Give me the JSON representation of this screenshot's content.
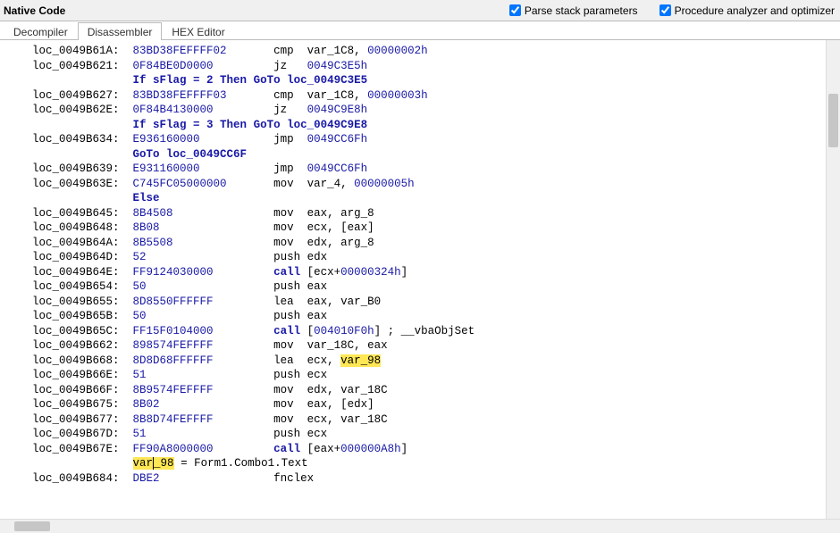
{
  "header": {
    "title": "Native Code",
    "checkbox1": {
      "label": "Parse stack parameters",
      "checked": true
    },
    "checkbox2": {
      "label": "Procedure analyzer and optimizer",
      "checked": true
    }
  },
  "tabs": [
    {
      "label": "Decompiler",
      "active": false
    },
    {
      "label": "Disassembler",
      "active": true
    },
    {
      "label": "HEX Editor",
      "active": false
    }
  ],
  "code_lines": [
    {
      "t": "asm",
      "addr": "loc_0049B61A:",
      "hex": "83BD38FEFFFF02",
      "mn": "cmp",
      "args": [
        {
          "v": "var_1C8"
        },
        ", ",
        {
          "v": "00000002h",
          "c": "num"
        }
      ]
    },
    {
      "t": "asm",
      "addr": "loc_0049B621:",
      "hex": "0F84BE0D0000",
      "mn": "jz",
      "args": [
        {
          "v": "0049C3E5h",
          "c": "ref"
        }
      ]
    },
    {
      "t": "pseudo",
      "text_pre": "If sFlag = 2 Then ",
      "kw": "GoTo",
      "text_post": " loc_0049C3E5"
    },
    {
      "t": "asm",
      "addr": "loc_0049B627:",
      "hex": "83BD38FEFFFF03",
      "mn": "cmp",
      "args": [
        {
          "v": "var_1C8"
        },
        ", ",
        {
          "v": "00000003h",
          "c": "num"
        }
      ]
    },
    {
      "t": "asm",
      "addr": "loc_0049B62E:",
      "hex": "0F84B4130000",
      "mn": "jz",
      "args": [
        {
          "v": "0049C9E8h",
          "c": "ref"
        }
      ]
    },
    {
      "t": "pseudo",
      "text_pre": "If sFlag = 3 Then ",
      "kw": "GoTo",
      "text_post": " loc_0049C9E8"
    },
    {
      "t": "asm",
      "addr": "loc_0049B634:",
      "hex": "E936160000",
      "mn": "jmp",
      "args": [
        {
          "v": "0049CC6Fh",
          "c": "ref"
        }
      ]
    },
    {
      "t": "pseudo",
      "kw": "GoTo",
      "text_post": " loc_0049CC6F"
    },
    {
      "t": "asm",
      "addr": "loc_0049B639:",
      "hex": "E931160000",
      "mn": "jmp",
      "args": [
        {
          "v": "0049CC6Fh",
          "c": "ref"
        }
      ]
    },
    {
      "t": "asm",
      "addr": "loc_0049B63E:",
      "hex": "C745FC05000000",
      "mn": "mov",
      "args": [
        {
          "v": "var_4"
        },
        ", ",
        {
          "v": "00000005h",
          "c": "num"
        }
      ]
    },
    {
      "t": "pseudo",
      "kw": "Else"
    },
    {
      "t": "asm",
      "addr": "loc_0049B645:",
      "hex": "8B4508",
      "mn": "mov",
      "args": [
        {
          "v": "eax"
        },
        ", ",
        {
          "v": "arg_8"
        }
      ]
    },
    {
      "t": "asm",
      "addr": "loc_0049B648:",
      "hex": "8B08",
      "mn": "mov",
      "args": [
        {
          "v": "ecx"
        },
        ", [",
        {
          "v": "eax"
        },
        "]"
      ]
    },
    {
      "t": "asm",
      "addr": "loc_0049B64A:",
      "hex": "8B5508",
      "mn": "mov",
      "args": [
        {
          "v": "edx"
        },
        ", ",
        {
          "v": "arg_8"
        }
      ]
    },
    {
      "t": "asm",
      "addr": "loc_0049B64D:",
      "hex": "52",
      "mn": "push",
      "args": [
        {
          "v": "edx"
        }
      ]
    },
    {
      "t": "asm",
      "addr": "loc_0049B64E:",
      "hex": "FF9124030000",
      "mn": "call",
      "args": [
        "[",
        {
          "v": "ecx"
        },
        "+",
        {
          "v": "00000324h",
          "c": "num"
        },
        "]"
      ],
      "mn_kw": true
    },
    {
      "t": "asm",
      "addr": "loc_0049B654:",
      "hex": "50",
      "mn": "push",
      "args": [
        {
          "v": "eax"
        }
      ]
    },
    {
      "t": "asm",
      "addr": "loc_0049B655:",
      "hex": "8D8550FFFFFF",
      "mn": "lea",
      "args": [
        {
          "v": "eax"
        },
        ", ",
        {
          "v": "var_B0"
        }
      ]
    },
    {
      "t": "asm",
      "addr": "loc_0049B65B:",
      "hex": "50",
      "mn": "push",
      "args": [
        {
          "v": "eax"
        }
      ]
    },
    {
      "t": "asm",
      "addr": "loc_0049B65C:",
      "hex": "FF15F0104000",
      "mn": "call",
      "args": [
        "[",
        {
          "v": "004010F0h",
          "c": "ref"
        },
        "] ; __vbaObjSet"
      ],
      "mn_kw": true
    },
    {
      "t": "asm",
      "addr": "loc_0049B662:",
      "hex": "898574FEFFFF",
      "mn": "mov",
      "args": [
        {
          "v": "var_18C"
        },
        ", ",
        {
          "v": "eax"
        }
      ]
    },
    {
      "t": "asm",
      "addr": "loc_0049B668:",
      "hex": "8D8D68FFFFFF",
      "mn": "lea",
      "args": [
        {
          "v": "ecx"
        },
        ", ",
        {
          "v": "var_98",
          "c": "hl"
        }
      ]
    },
    {
      "t": "asm",
      "addr": "loc_0049B66E:",
      "hex": "51",
      "mn": "push",
      "args": [
        {
          "v": "ecx"
        }
      ]
    },
    {
      "t": "asm",
      "addr": "loc_0049B66F:",
      "hex": "8B9574FEFFFF",
      "mn": "mov",
      "args": [
        {
          "v": "edx"
        },
        ", ",
        {
          "v": "var_18C"
        }
      ]
    },
    {
      "t": "asm",
      "addr": "loc_0049B675:",
      "hex": "8B02",
      "mn": "mov",
      "args": [
        {
          "v": "eax"
        },
        ", [",
        {
          "v": "edx"
        },
        "]"
      ]
    },
    {
      "t": "asm",
      "addr": "loc_0049B677:",
      "hex": "8B8D74FEFFFF",
      "mn": "mov",
      "args": [
        {
          "v": "ecx"
        },
        ", ",
        {
          "v": "var_18C"
        }
      ]
    },
    {
      "t": "asm",
      "addr": "loc_0049B67D:",
      "hex": "51",
      "mn": "push",
      "args": [
        {
          "v": "ecx"
        }
      ]
    },
    {
      "t": "asm",
      "addr": "loc_0049B67E:",
      "hex": "FF90A8000000",
      "mn": "call",
      "args": [
        "[",
        {
          "v": "eax"
        },
        "+",
        {
          "v": "000000A8h",
          "c": "num"
        },
        "]"
      ],
      "mn_kw": true
    },
    {
      "t": "pseudo_hl",
      "hl_pre": "var",
      "hl_cursor": true,
      "hl_post": "_98",
      "rest": " = Form1.Combo1.Text"
    },
    {
      "t": "asm",
      "addr": "loc_0049B684:",
      "hex": "DBE2",
      "mn": "fnclex",
      "args": []
    }
  ]
}
